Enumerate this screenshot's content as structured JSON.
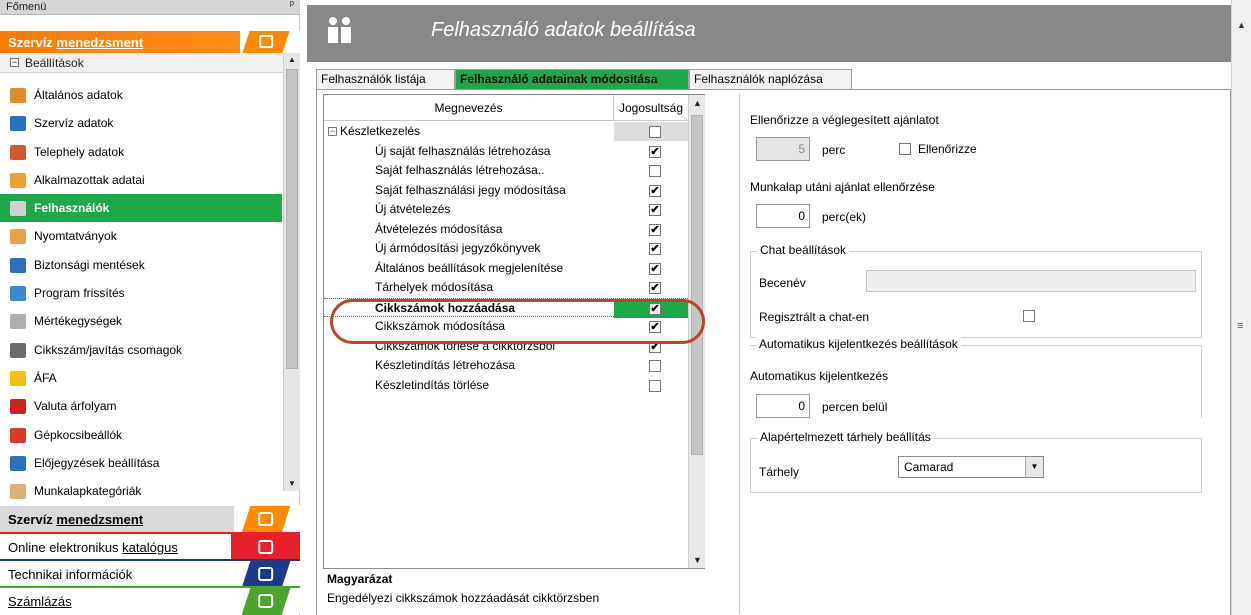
{
  "sidebar": {
    "title": "Főmenü",
    "pin": "ᵖ",
    "top_category": {
      "label_a": "Szervíz ",
      "label_b": "menedzsment"
    },
    "section": {
      "expander": "−",
      "label": "Beállítások"
    },
    "items": [
      {
        "label": "Általános adatok",
        "color": "#e08a2a"
      },
      {
        "label": "Szervíz adatok",
        "color": "#2b6cc4"
      },
      {
        "label": "Telephely adatok",
        "color": "#d05a2a"
      },
      {
        "label": "Alkalmazottak adatai",
        "color": "#f0a030"
      },
      {
        "label": "Felhasználók",
        "color": "#d0d0d0"
      },
      {
        "label": "Nyomtatványok",
        "color": "#e6a34a"
      },
      {
        "label": "Biztonsági mentések",
        "color": "#2d6fbf"
      },
      {
        "label": "Program frissítés",
        "color": "#3c89d0"
      },
      {
        "label": "Mértékegységek",
        "color": "#b0b0b0"
      },
      {
        "label": "Cikkszám/javítás csomagok",
        "color": "#6a6a6a"
      },
      {
        "label": "ÁFA",
        "color": "#f2c10e"
      },
      {
        "label": "Valuta árfolyam",
        "color": "#d02020"
      },
      {
        "label": "Gépkocsibeállók",
        "color": "#d83a2a"
      },
      {
        "label": "Előjegyzések beállítása",
        "color": "#2d6fbf"
      },
      {
        "label": "Munkalapkategóriák",
        "color": "#d9b27a"
      }
    ],
    "bottom_categories": [
      {
        "label_a": "Szervíz ",
        "label_b": "menedzsment",
        "style": "orange"
      },
      {
        "label_a": "Online elektronikus ",
        "label_b": "katalógus",
        "style": "red"
      },
      {
        "label_a": "Technikai információk",
        "label_b": "",
        "style": "blue"
      },
      {
        "label_a": "",
        "label_b": "Számlázás",
        "style": "green"
      }
    ]
  },
  "main": {
    "title": "Felhasználó adatok beállítása",
    "tabs": [
      "Felhasználók listája",
      "Felhasználó adatainak módosítása",
      "Felhasználók naplózása"
    ],
    "grid": {
      "col_name": "Megnevezés",
      "col_perm": "Jogosultság",
      "group": {
        "label": "Készletkezelés",
        "expander": "−"
      },
      "rows": [
        {
          "label": "Új saját felhasználás létrehozása",
          "mark": "✔"
        },
        {
          "label": "Saját felhasználás létrehozása..",
          "mark": ""
        },
        {
          "label": "Saját felhasználási jegy módosítása",
          "mark": "✔"
        },
        {
          "label": "Új átvételezés",
          "mark": "✔"
        },
        {
          "label": "Átvételezés módosítása",
          "mark": "✔"
        },
        {
          "label": "Új ármódosítási jegyzőkönyvek",
          "mark": "✔"
        },
        {
          "label": "Általános beállítások megjelenítése",
          "mark": "✔"
        },
        {
          "label": "Tárhelyek módosítása",
          "mark": "✔"
        },
        {
          "label": "Cikkszámok hozzáadása",
          "mark": "✔"
        },
        {
          "label": "Cikkszámok módosítása",
          "mark": "✔"
        },
        {
          "label": "Cikkszámok törlése a cikktörzsből",
          "mark": "✔"
        },
        {
          "label": "Készletindítás létrehozása",
          "mark": ""
        },
        {
          "label": "Készletindítás törlése",
          "mark": ""
        }
      ]
    },
    "explanation": {
      "title": "Magyarázat",
      "text": "Engedélyezi cikkszámok hozzáadását cikktörzsben"
    },
    "settings": {
      "offer_check_label": "Ellenőrizze a véglegesített ajánlatot",
      "offer_check_value": "5",
      "offer_check_unit": "perc",
      "offer_check_cb": "Ellenőrizze",
      "worksheet_offer_label": "Munkalap utáni ajánlat ellenőrzése",
      "worksheet_offer_value": "0",
      "worksheet_offer_unit": "perc(ek)",
      "chat_legend": "Chat beállítások",
      "chat_nick_label": "Becenév",
      "chat_registered_label": "Regisztrált a chat-en",
      "auto_logout_legend": "Automatikus kijelentkezés beállítások",
      "auto_logout_label": "Automatikus kijelentkezés",
      "auto_logout_value": "0",
      "auto_logout_unit": "percen belül",
      "storage_legend": "Alapértelmezett tárhely beállítás",
      "storage_label": "Tárhely",
      "storage_value": "Camarad"
    }
  }
}
